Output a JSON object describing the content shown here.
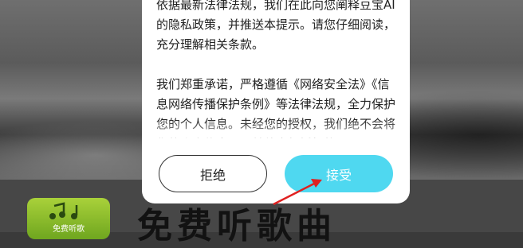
{
  "background": {
    "promo_text": "免费听歌曲",
    "app_icon_label": "免费听歌",
    "app_icon": "music-note-icon"
  },
  "dialog": {
    "paragraphs": [
      "依据最新法律法规，我们在此向您阐释豆宝AI的隐私政策，并推送本提示。请您仔细阅读，充分理解相关条款。",
      "我们郑重承诺，严格遵循《网络安全法》《信息网络传播保护条例》等法律法规，全力保护您的个人信息。未经您的授权，我们绝不会将您的个人信息用于其他未经授权的"
    ],
    "reject_label": "拒绝",
    "accept_label": "接受"
  },
  "annotation": {
    "arrow_color": "#e02020"
  },
  "colors": {
    "accept_button": "#4fd8f0"
  }
}
